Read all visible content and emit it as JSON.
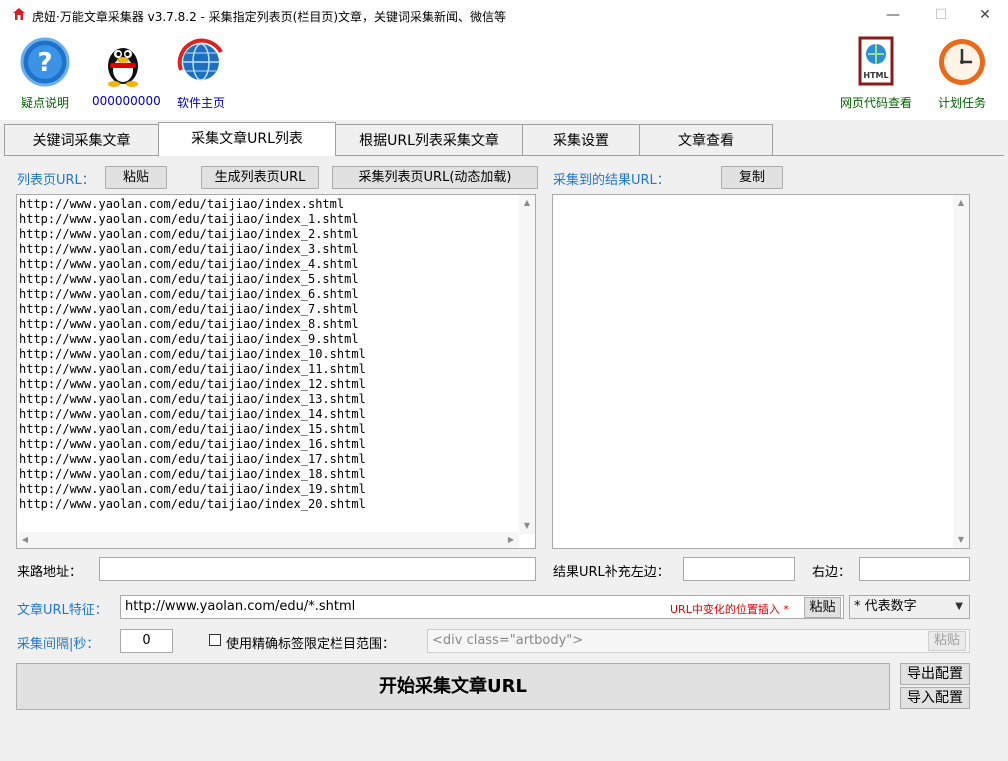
{
  "window": {
    "title": "虎妞·万能文章采集器 v3.7.8.2 - 采集指定列表页(栏目页)文章，关键词采集新闻、微信等",
    "minimize": "—",
    "maximize": "☐",
    "close": "✕"
  },
  "toolbar": {
    "help_label": "疑点说明",
    "qq_label": "000000000",
    "home_label": "软件主页",
    "html_label": "网页代码查看",
    "schedule_label": "计划任务",
    "html_icon_text": "HTML"
  },
  "tabs": [
    {
      "label": "关键词采集文章"
    },
    {
      "label": "采集文章URL列表"
    },
    {
      "label": "根据URL列表采集文章"
    },
    {
      "label": "采集设置"
    },
    {
      "label": "文章查看"
    }
  ],
  "list_page": {
    "label": "列表页URL：",
    "paste_button": "粘贴",
    "generate_button": "生成列表页URL",
    "collect_button": "采集列表页URL(动态加载)",
    "urls": [
      "http://www.yaolan.com/edu/taijiao/index.shtml",
      "http://www.yaolan.com/edu/taijiao/index_1.shtml",
      "http://www.yaolan.com/edu/taijiao/index_2.shtml",
      "http://www.yaolan.com/edu/taijiao/index_3.shtml",
      "http://www.yaolan.com/edu/taijiao/index_4.shtml",
      "http://www.yaolan.com/edu/taijiao/index_5.shtml",
      "http://www.yaolan.com/edu/taijiao/index_6.shtml",
      "http://www.yaolan.com/edu/taijiao/index_7.shtml",
      "http://www.yaolan.com/edu/taijiao/index_8.shtml",
      "http://www.yaolan.com/edu/taijiao/index_9.shtml",
      "http://www.yaolan.com/edu/taijiao/index_10.shtml",
      "http://www.yaolan.com/edu/taijiao/index_11.shtml",
      "http://www.yaolan.com/edu/taijiao/index_12.shtml",
      "http://www.yaolan.com/edu/taijiao/index_13.shtml",
      "http://www.yaolan.com/edu/taijiao/index_14.shtml",
      "http://www.yaolan.com/edu/taijiao/index_15.shtml",
      "http://www.yaolan.com/edu/taijiao/index_16.shtml",
      "http://www.yaolan.com/edu/taijiao/index_17.shtml",
      "http://www.yaolan.com/edu/taijiao/index_18.shtml",
      "http://www.yaolan.com/edu/taijiao/index_19.shtml",
      "http://www.yaolan.com/edu/taijiao/index_20.shtml"
    ]
  },
  "results": {
    "label": "采集到的结果URL：",
    "copy_button": "复制"
  },
  "referer": {
    "label": "来路地址：",
    "value": ""
  },
  "result_pad": {
    "left_label": "结果URL补充左边：",
    "left_value": "",
    "right_label": "右边：",
    "right_value": ""
  },
  "feature": {
    "label": "文章URL特征：",
    "value": "http://www.yaolan.com/edu/*.shtml",
    "note": "URL中变化的位置插入 *",
    "paste_button": "粘贴",
    "select_value": "* 代表数字"
  },
  "interval": {
    "label": "采集间隔|秒：",
    "value": "0",
    "checkbox_label": "使用精确标签限定栏目范围：",
    "tag_value": "<div class=\"artbody\">",
    "paste_button": "粘贴"
  },
  "actions": {
    "start_button": "开始采集文章URL",
    "export_button": "导出配置",
    "import_button": "导入配置"
  },
  "colors": {
    "accent_blue": "#2277cc",
    "toolbar_green": "#006400",
    "note_red": "#e00000"
  }
}
